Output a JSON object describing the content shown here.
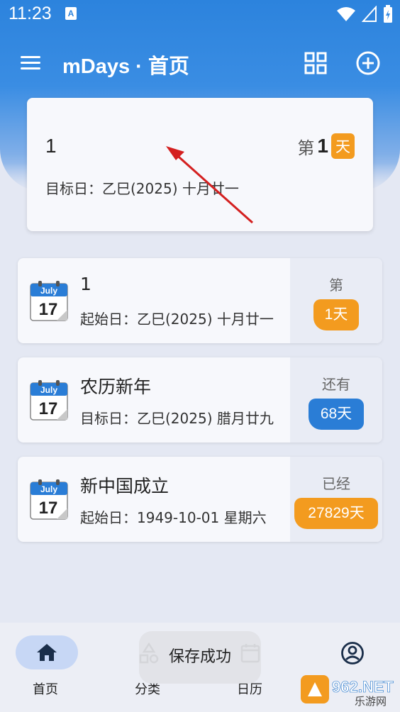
{
  "status_bar": {
    "time": "11:23",
    "notification_icon": "A"
  },
  "app_bar": {
    "title": "mDays · 首页"
  },
  "featured": {
    "title": "1",
    "date": "目标日：乙巳(2025) 十月廿一",
    "prefix": "第",
    "number": "1",
    "unit": "天"
  },
  "events": [
    {
      "month": "July",
      "day": "17",
      "title": "1",
      "date": "起始日：乙巳(2025) 十月廿一",
      "label": "第",
      "badge": "1天",
      "badge_color": "#f39b1f"
    },
    {
      "month": "July",
      "day": "17",
      "title": "农历新年",
      "date": "目标日：乙巳(2025) 腊月廿九",
      "label": "还有",
      "badge": "68天",
      "badge_color": "#2a7dd6"
    },
    {
      "month": "July",
      "day": "17",
      "title": "新中国成立",
      "date": "起始日：1949-10-01 星期六",
      "label": "已经",
      "badge": "27829天",
      "badge_color": "#f39b1f"
    }
  ],
  "bottom_nav": {
    "home": "首页",
    "category": "分类",
    "calendar": "日历"
  },
  "toast": "保存成功",
  "watermark": {
    "brand": "962.NET",
    "sub": "乐游网"
  },
  "colors": {
    "primary": "#2c83dd",
    "orange": "#f39b1f",
    "blue_badge": "#2a7dd6"
  }
}
